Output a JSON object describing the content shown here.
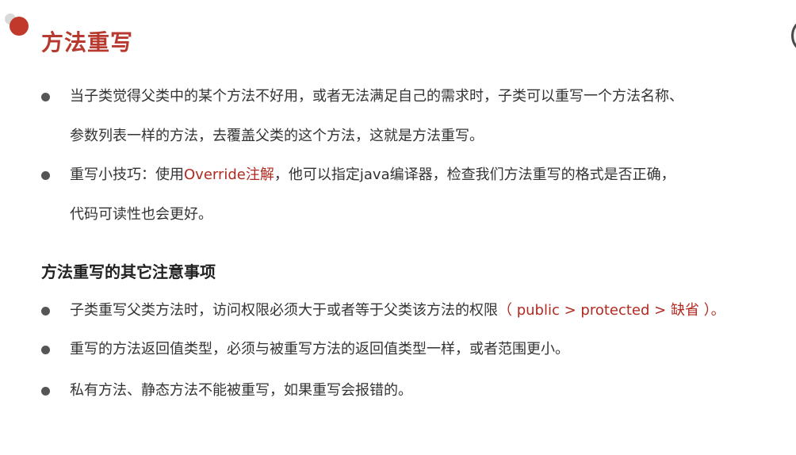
{
  "title": "方法重写",
  "intro_bullets": [
    {
      "lines": [
        "当子类觉得父类中的某个方法不好用，或者无法满足自己的需求时，子类可以重写一个方法名称、",
        "参数列表一样的方法，去覆盖父类的这个方法，这就是方法重写。"
      ]
    },
    {
      "line1_pre": "重写小技巧：使用",
      "line1_highlight": "Override注解",
      "line1_post": "，他可以指定java编译器，检查我们方法重写的格式是否正确，",
      "line2": "代码可读性也会更好。"
    }
  ],
  "section_heading": "方法重写的其它注意事项",
  "notes": [
    {
      "text": "子类重写父类方法时，访问权限必须大于或者等于父类该方法的权限",
      "highlight": "（ public > protected > 缺省 ）。"
    },
    {
      "text": "重写的方法返回值类型，必须与被重写方法的返回值类型一样，或者范围更小。"
    },
    {
      "text": "私有方法、静态方法不能被重写，如果重写会报错的。"
    }
  ],
  "colors": {
    "accent": "#b83a2f",
    "highlight_text": "#b22a21",
    "body_text": "#333333",
    "bullet": "#555555"
  }
}
